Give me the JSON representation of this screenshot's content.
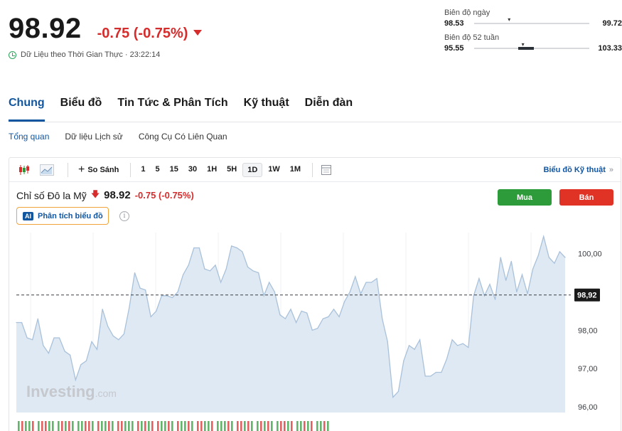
{
  "header": {
    "last_price": "98.92",
    "change": "-0.75 (-0.75%)",
    "realtime_label": "Dữ Liệu theo Thời Gian Thực · 23:22:14"
  },
  "ranges": [
    {
      "label": "Biên độ ngày",
      "low": "98.53",
      "high": "99.72",
      "marker": 0.31,
      "fill": null
    },
    {
      "label": "Biên độ 52 tuần",
      "low": "95.55",
      "high": "103.33",
      "marker": 0.43,
      "fill": [
        0.38,
        0.52
      ]
    }
  ],
  "tabs": [
    {
      "label": "Chung",
      "active": true
    },
    {
      "label": "Biểu đồ",
      "active": false
    },
    {
      "label": "Tin Tức & Phân Tích",
      "active": false
    },
    {
      "label": "Kỹ thuật",
      "active": false
    },
    {
      "label": "Diễn đàn",
      "active": false
    }
  ],
  "subtabs": [
    {
      "label": "Tổng quan",
      "active": true
    },
    {
      "label": "Dữ liệu Lịch sử",
      "active": false
    },
    {
      "label": "Công Cụ Có Liên Quan",
      "active": false
    }
  ],
  "toolbar": {
    "compare_label": "So Sánh",
    "intervals": [
      "1",
      "5",
      "15",
      "30",
      "1H",
      "5H",
      "1D",
      "1W",
      "1M"
    ],
    "active_interval": "1D",
    "technical_link": "Biểu đồ Kỹ thuật",
    "icons": [
      "candlestick-icon",
      "area-chart-icon",
      "plus-icon",
      "calendar-grid-icon",
      "double-chevron-right-icon"
    ]
  },
  "symbol": {
    "name": "Chỉ số Đô la Mỹ",
    "price": "98.92",
    "change": "-0.75 (-0.75%)"
  },
  "ai_button": {
    "badge": "AI",
    "label": "Phân tích biểu đồ"
  },
  "buy_label": "Mua",
  "sell_label": "Bán",
  "watermark": "Investing.com",
  "colors": {
    "accent": "#1256a0",
    "down": "#d62c2c",
    "buy": "#2e9b3a",
    "sell": "#e03326",
    "area_fill": "#dfe9f3",
    "area_line": "#a9c1da"
  },
  "chart_data": {
    "type": "area",
    "y_ticks": [
      "100,00",
      "99,00",
      "98,00",
      "97,00",
      "96,00"
    ],
    "y_tick_values": [
      100,
      99,
      98,
      97,
      96
    ],
    "ylim": [
      95.85,
      100.55
    ],
    "current_value": 98.92,
    "current_label": "98,92",
    "grid": "vertical",
    "values": [
      98.2,
      98.2,
      97.8,
      97.75,
      98.3,
      97.6,
      97.4,
      97.8,
      97.8,
      97.45,
      97.35,
      96.7,
      97.1,
      97.2,
      97.7,
      97.5,
      98.55,
      98.1,
      97.85,
      97.75,
      97.9,
      98.6,
      99.5,
      99.1,
      99.05,
      98.35,
      98.5,
      98.9,
      98.9,
      98.85,
      99.0,
      99.45,
      99.7,
      100.15,
      100.15,
      99.6,
      99.55,
      99.7,
      99.25,
      99.6,
      100.2,
      100.15,
      100.05,
      99.65,
      99.55,
      99.5,
      98.9,
      99.25,
      99.0,
      98.4,
      98.3,
      98.55,
      98.2,
      98.5,
      98.45,
      98.0,
      98.05,
      98.3,
      98.35,
      98.55,
      98.35,
      98.75,
      99.0,
      99.4,
      98.95,
      99.25,
      99.25,
      99.35,
      98.3,
      97.7,
      96.25,
      96.4,
      97.2,
      97.6,
      97.5,
      97.75,
      96.8,
      96.8,
      96.9,
      96.9,
      97.25,
      97.75,
      97.6,
      97.65,
      97.55,
      98.9,
      99.35,
      98.9,
      99.2,
      98.8,
      99.9,
      99.3,
      99.8,
      99.0,
      99.45,
      98.95,
      99.6,
      99.95,
      100.45,
      99.9,
      99.75,
      100.05,
      99.9
    ]
  }
}
